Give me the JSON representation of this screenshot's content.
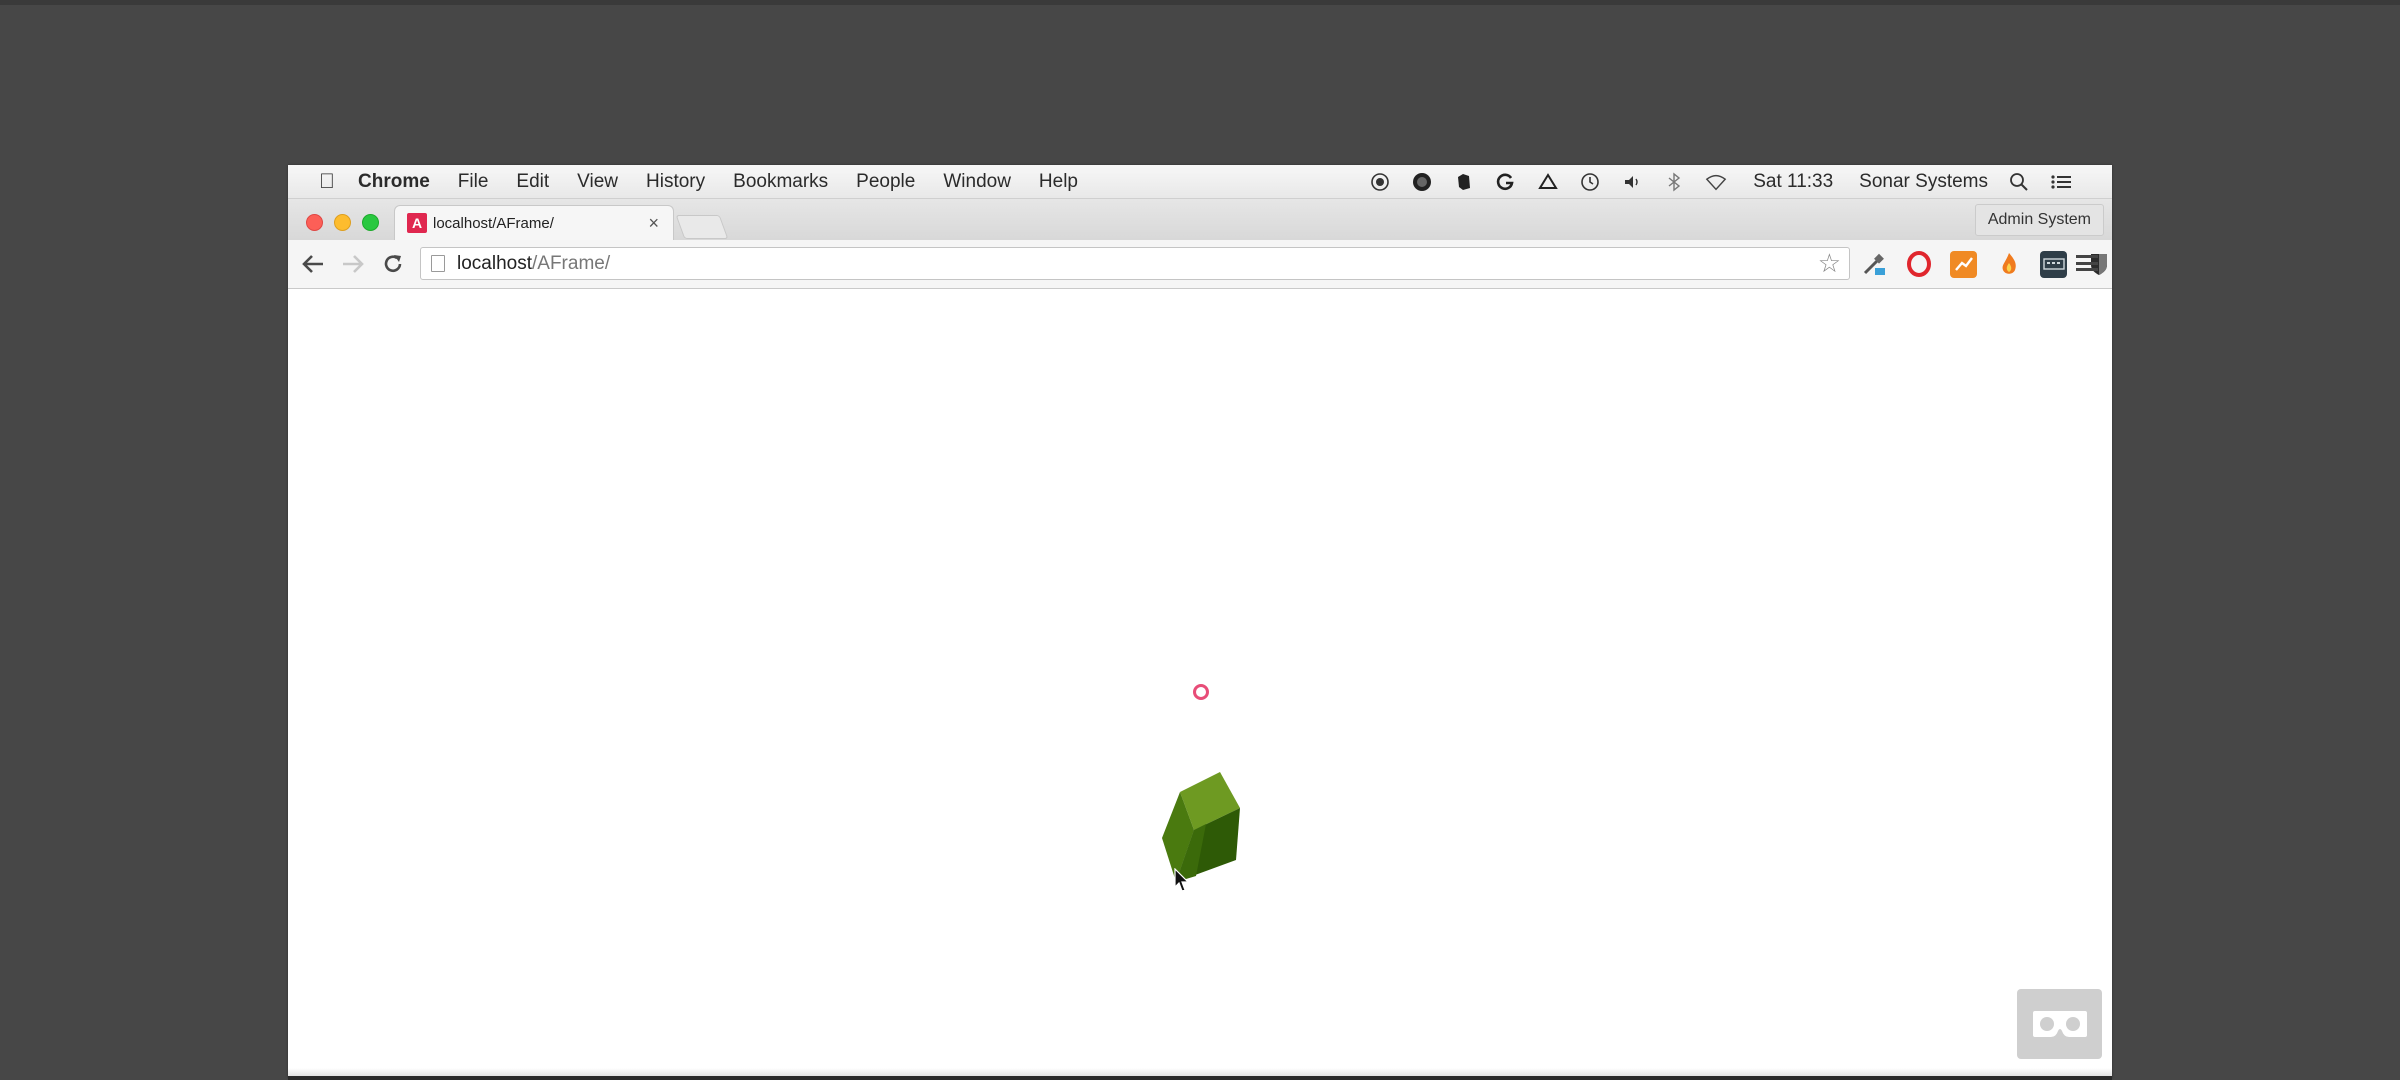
{
  "menubar": {
    "apple_icon": "apple-icon",
    "items": [
      {
        "label": "Chrome"
      },
      {
        "label": "File"
      },
      {
        "label": "Edit"
      },
      {
        "label": "View"
      },
      {
        "label": "History"
      },
      {
        "label": "Bookmarks"
      },
      {
        "label": "People"
      },
      {
        "label": "Window"
      },
      {
        "label": "Help"
      }
    ],
    "clock": "Sat 11:33",
    "user": "Sonar Systems"
  },
  "tab": {
    "favicon_letter": "A",
    "title": "localhost/AFrame/",
    "close": "×"
  },
  "profile": {
    "label": "Admin System"
  },
  "omnibox": {
    "host": "localhost",
    "path": "/AFrame/"
  },
  "colors": {
    "cube_top": "#6e9a22",
    "cube_left": "#4a7a0f",
    "cube_right": "#2e5a06",
    "reticle": "#e84d78",
    "favicon": "#e0274f"
  }
}
